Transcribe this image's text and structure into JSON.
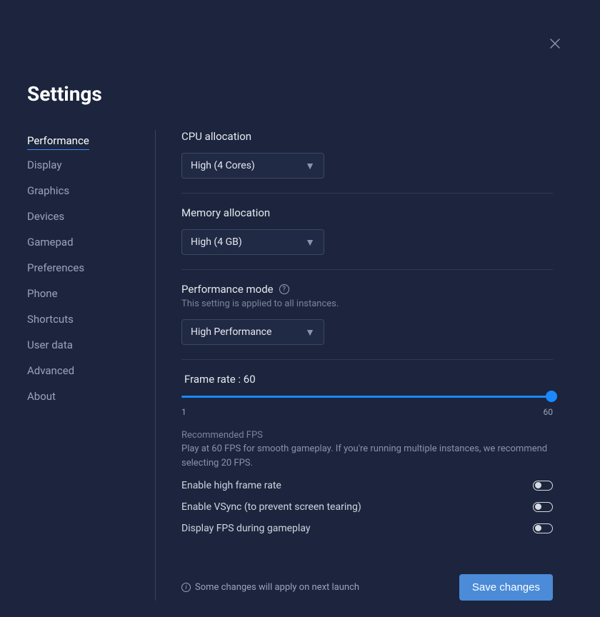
{
  "title": "Settings",
  "sidebar": {
    "items": [
      {
        "label": "Performance",
        "active": true
      },
      {
        "label": "Display"
      },
      {
        "label": "Graphics"
      },
      {
        "label": "Devices"
      },
      {
        "label": "Gamepad"
      },
      {
        "label": "Preferences"
      },
      {
        "label": "Phone"
      },
      {
        "label": "Shortcuts"
      },
      {
        "label": "User data"
      },
      {
        "label": "Advanced"
      },
      {
        "label": "About"
      }
    ]
  },
  "cpu": {
    "label": "CPU allocation",
    "value": "High (4 Cores)"
  },
  "memory": {
    "label": "Memory allocation",
    "value": "High (4 GB)"
  },
  "perfmode": {
    "label": "Performance mode",
    "hint": "This setting is applied to all instances.",
    "value": "High Performance"
  },
  "framerate": {
    "label_prefix": "Frame rate : ",
    "value": "60",
    "min": "1",
    "max": "60",
    "rec_title": "Recommended FPS",
    "rec_desc": "Play at 60 FPS for smooth gameplay. If you're running multiple instances, we recommend selecting 20 FPS."
  },
  "toggles": {
    "high_fps": {
      "label": "Enable high frame rate",
      "on": false
    },
    "vsync": {
      "label": "Enable VSync (to prevent screen tearing)",
      "on": false
    },
    "display_fps": {
      "label": "Display FPS during gameplay",
      "on": false
    }
  },
  "footer": {
    "note": "Some changes will apply on next launch",
    "save": "Save changes"
  }
}
